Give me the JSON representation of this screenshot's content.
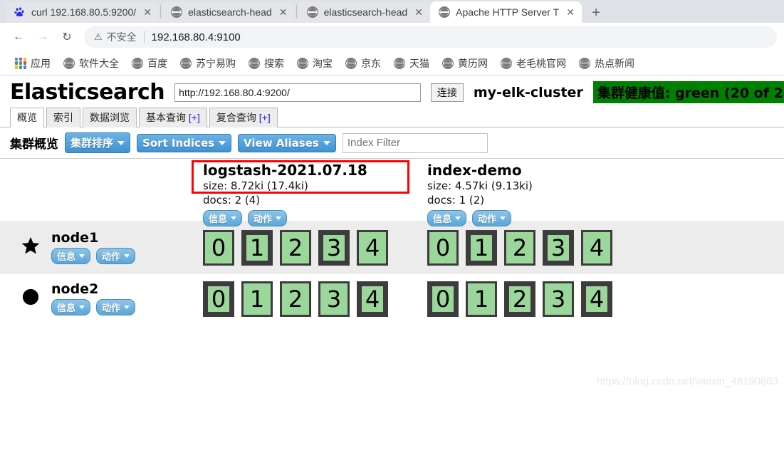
{
  "browser": {
    "tabs": [
      {
        "title": "curl 192.168.80.5:9200/",
        "favicon": "baidu-paw-icon",
        "state": "inactive"
      },
      {
        "title": "elasticsearch-head",
        "favicon": "globe-icon",
        "state": "inactive"
      },
      {
        "title": "elasticsearch-head",
        "favicon": "globe-icon",
        "state": "inactive"
      },
      {
        "title": "Apache HTTP Server T",
        "favicon": "globe-icon",
        "state": "active"
      }
    ],
    "new_tab_label": "+",
    "close_label": "✕",
    "nav": {
      "back": "←",
      "forward": "→",
      "reload": "↻"
    },
    "omnibox": {
      "warning_icon": "⚠",
      "security_label": "不安全",
      "url": "192.168.80.4:9100"
    },
    "bookmarks": [
      {
        "label": "应用",
        "icon": "apps-grid-icon"
      },
      {
        "label": "软件大全",
        "icon": "globe-icon"
      },
      {
        "label": "百度",
        "icon": "globe-icon"
      },
      {
        "label": "苏宁易购",
        "icon": "globe-icon"
      },
      {
        "label": "搜索",
        "icon": "globe-icon"
      },
      {
        "label": "淘宝",
        "icon": "globe-icon"
      },
      {
        "label": "京东",
        "icon": "globe-icon"
      },
      {
        "label": "天猫",
        "icon": "globe-icon"
      },
      {
        "label": "黄历网",
        "icon": "globe-icon"
      },
      {
        "label": "老毛桃官网",
        "icon": "globe-icon"
      },
      {
        "label": "热点新闻",
        "icon": "globe-icon"
      }
    ]
  },
  "app": {
    "logo": "Elasticsearch",
    "connect_url": "http://192.168.80.4:9200/",
    "connect_button": "连接",
    "cluster_name": "my-elk-cluster",
    "health": "集群健康值: green (20 of 2",
    "health_color": "#008000",
    "tabs": [
      {
        "label": "概览",
        "plus": "",
        "active": true
      },
      {
        "label": "索引",
        "plus": "",
        "active": false
      },
      {
        "label": "数据浏览",
        "plus": "",
        "active": false
      },
      {
        "label": "基本查询",
        "plus": "[+]",
        "active": false
      },
      {
        "label": "复合查询",
        "plus": "[+]",
        "active": false
      }
    ],
    "toolbar": {
      "title": "集群概览",
      "sort_cluster": "集群排序",
      "sort_indices": "Sort Indices",
      "view_aliases": "View Aliases",
      "filter_value": "",
      "filter_placeholder": "Index Filter"
    },
    "pill_info": "信息",
    "pill_action": "动作",
    "indices": [
      {
        "name": "logstash-2021.07.18",
        "size": "size: 8.72ki (17.4ki)",
        "docs": "docs: 2 (4)",
        "annotated": true
      },
      {
        "name": "index-demo",
        "size": "size: 4.57ki (9.13ki)",
        "docs": "docs: 1 (2)",
        "annotated": false
      }
    ],
    "nodes": [
      {
        "name": "node1",
        "marker": "star-icon",
        "shards": [
          {
            "labels": [
              "0",
              "1",
              "2",
              "3",
              "4"
            ],
            "primary": [
              false,
              true,
              false,
              true,
              false
            ]
          },
          {
            "labels": [
              "0",
              "1",
              "2",
              "3",
              "4"
            ],
            "primary": [
              false,
              true,
              false,
              true,
              false
            ]
          }
        ]
      },
      {
        "name": "node2",
        "marker": "circle-icon",
        "shards": [
          {
            "labels": [
              "0",
              "1",
              "2",
              "3",
              "4"
            ],
            "primary": [
              true,
              false,
              false,
              false,
              true
            ]
          },
          {
            "labels": [
              "0",
              "1",
              "2",
              "3",
              "4"
            ],
            "primary": [
              true,
              false,
              true,
              false,
              true
            ]
          }
        ]
      }
    ],
    "watermark": "https://blog.csdn.net/weixin_48190863"
  }
}
